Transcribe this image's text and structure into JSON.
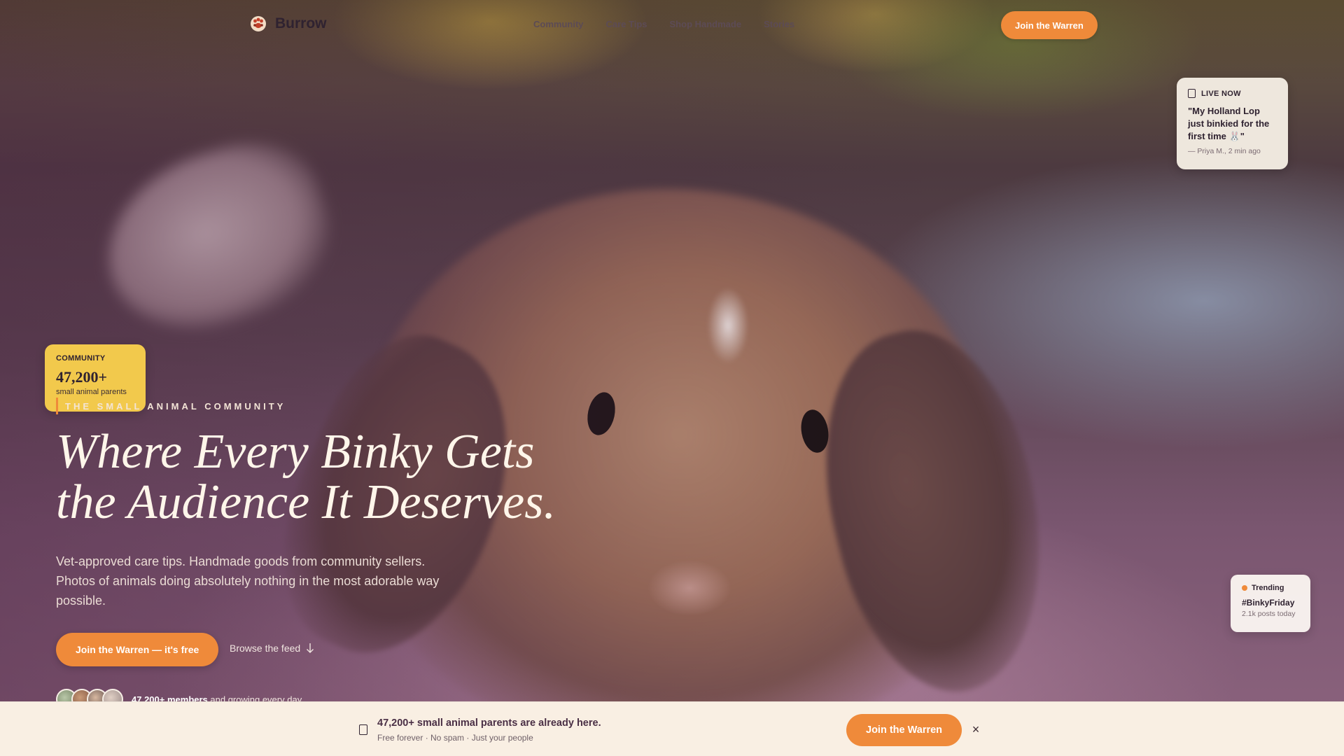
{
  "brand": {
    "name": "Burrow",
    "logo_icon": "paw-icon"
  },
  "nav": {
    "links": [
      "Community",
      "Care Tips",
      "Shop Handmade",
      "Stories"
    ],
    "cta_label": "Join the Warren"
  },
  "live_card": {
    "badge": "LIVE NOW",
    "quote": "\"My Holland Lop just binkied for the first time 🐰\"",
    "meta": "— Priya M., 2 min ago"
  },
  "stat_card": {
    "label": "COMMUNITY",
    "value": "47,200+",
    "sub": "small animal parents"
  },
  "hero": {
    "eyebrow": "THE SMALL ANIMAL COMMUNITY",
    "headline_line1": "Where Every Binky Gets",
    "headline_line2": "the Audience It Deserves.",
    "subcopy": "Vet-approved care tips. Handmade goods from community sellers. Photos of animals doing absolutely nothing in the most adorable way possible.",
    "cta_label": "Join the Warren — it's free",
    "browse_label": "Browse the feed",
    "members_bold": "47,200+ members",
    "members_rest": " and growing every day"
  },
  "trending": {
    "label": "Trending",
    "tag": "#BinkyFriday",
    "meta": "2.1k posts today"
  },
  "banner": {
    "title": "47,200+ small animal parents are already here.",
    "sub": "Free forever · No spam · Just your people",
    "cta_label": "Join the Warren",
    "close_glyph": "×"
  },
  "colors": {
    "accent": "#ef8a3a",
    "stat_card": "#f2c94c",
    "banner_bg": "#f9efe3",
    "ink": "#2f2230"
  }
}
